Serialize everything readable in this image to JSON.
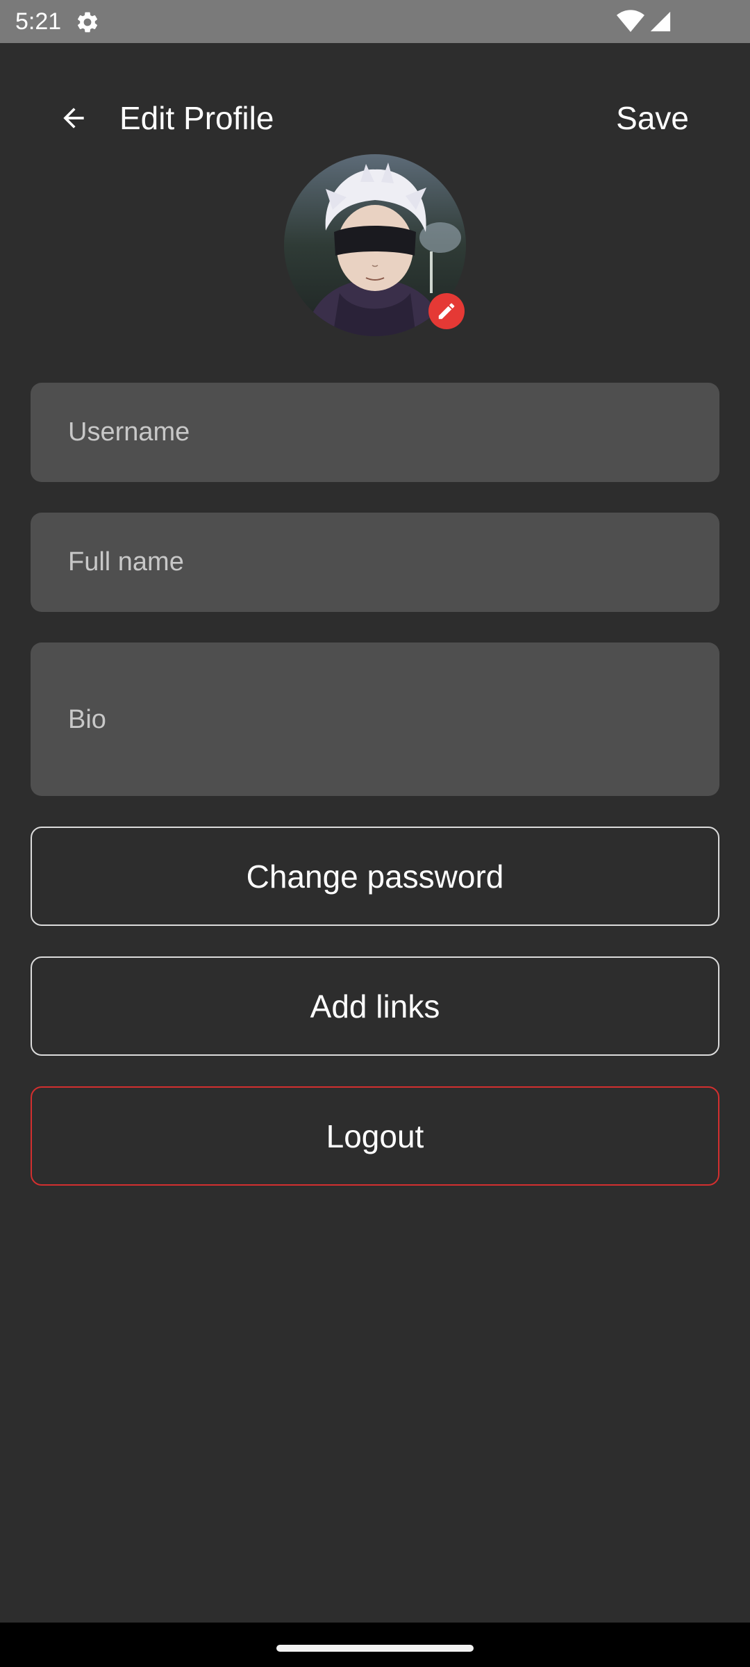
{
  "status_bar": {
    "time": "5:21",
    "icons": [
      "gear-icon",
      "wifi-icon",
      "signal-icon"
    ]
  },
  "header": {
    "title": "Edit Profile",
    "save_label": "Save",
    "back_icon": "arrow-left-icon"
  },
  "avatar": {
    "edit_icon": "pencil-icon",
    "edit_badge_color": "#e53935"
  },
  "form": {
    "username": {
      "placeholder": "Username",
      "value": ""
    },
    "full_name": {
      "placeholder": "Full name",
      "value": ""
    },
    "bio": {
      "placeholder": "Bio",
      "value": ""
    }
  },
  "actions": {
    "change_password_label": "Change password",
    "add_links_label": "Add links",
    "logout_label": "Logout",
    "logout_border_color": "#d32f2f"
  },
  "theme": {
    "background": "#2d2d2d",
    "field_background": "#4f4f4f",
    "status_bar_background": "#7a7a7a"
  }
}
